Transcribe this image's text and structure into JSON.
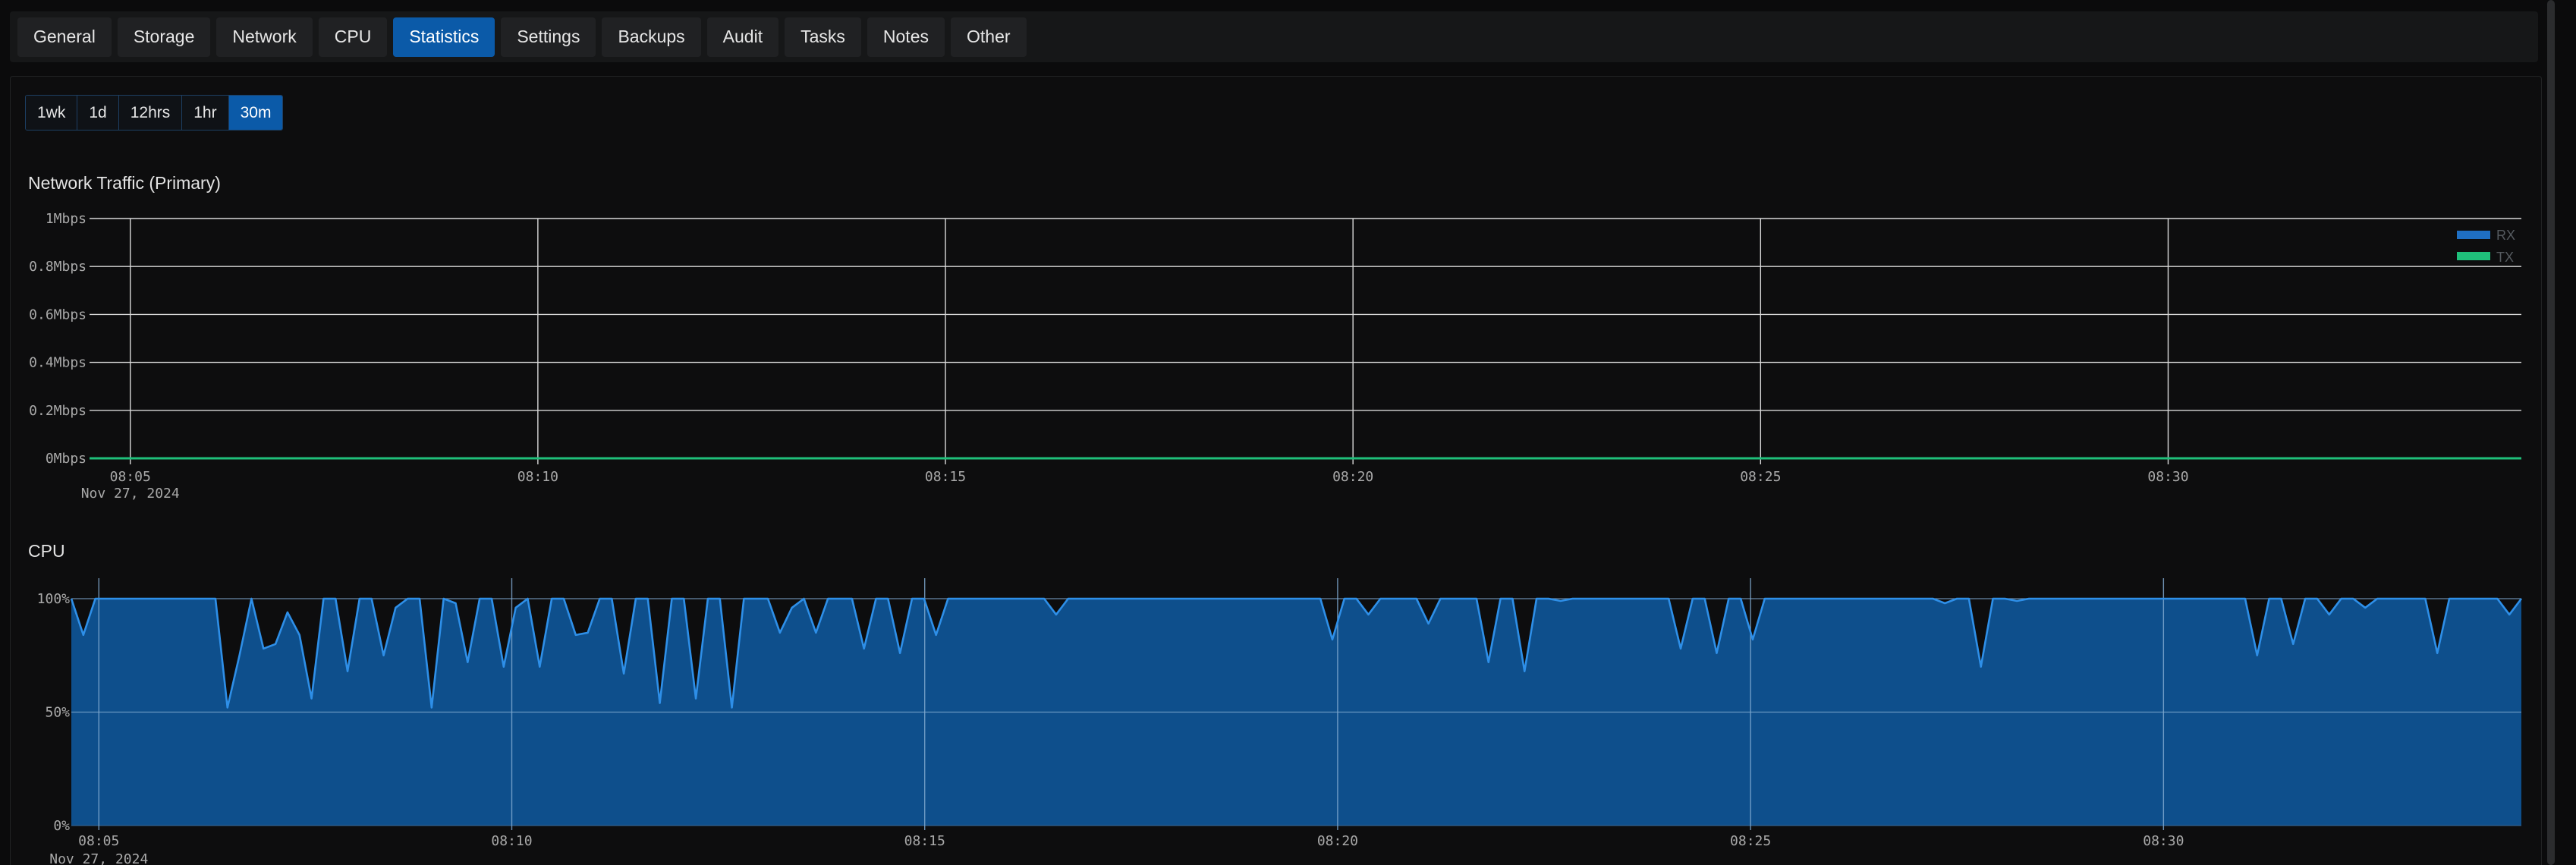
{
  "tabs": [
    {
      "label": "General"
    },
    {
      "label": "Storage"
    },
    {
      "label": "Network"
    },
    {
      "label": "CPU"
    },
    {
      "label": "Statistics",
      "active": true
    },
    {
      "label": "Settings"
    },
    {
      "label": "Backups"
    },
    {
      "label": "Audit"
    },
    {
      "label": "Tasks"
    },
    {
      "label": "Notes"
    },
    {
      "label": "Other"
    }
  ],
  "ranges": [
    {
      "label": "1wk"
    },
    {
      "label": "1d"
    },
    {
      "label": "12hrs"
    },
    {
      "label": "1hr"
    },
    {
      "label": "30m",
      "active": true
    }
  ],
  "colors": {
    "accent": "#0b5aa8",
    "rx": "#1f6fc4",
    "tx": "#1fbf7a",
    "cpu_line": "#2e8fe8",
    "cpu_fill": "#0e4f8c"
  },
  "network_chart": {
    "title": "Network Traffic (Primary)",
    "date_label": "Nov 27, 2024",
    "legend": [
      "RX",
      "TX"
    ]
  },
  "cpu_chart": {
    "title": "CPU",
    "date_label": "Nov 27, 2024"
  },
  "chart_data": [
    {
      "type": "line",
      "title": "Network Traffic (Primary)",
      "x_ticks": [
        "08:05",
        "08:10",
        "08:15",
        "08:20",
        "08:25",
        "08:30"
      ],
      "y_ticks": [
        "0Mbps",
        "0.2Mbps",
        "0.4Mbps",
        "0.6Mbps",
        "0.8Mbps",
        "1Mbps"
      ],
      "ylim": [
        0,
        1
      ],
      "x_range": [
        "08:04:30",
        "08:34:20"
      ],
      "grid": true,
      "legend_position": "top-right",
      "series": [
        {
          "name": "RX",
          "values": [
            0,
            0
          ]
        },
        {
          "name": "TX",
          "values": [
            0,
            0
          ]
        }
      ]
    },
    {
      "type": "area",
      "title": "CPU",
      "x_ticks": [
        "08:05",
        "08:10",
        "08:15",
        "08:20",
        "08:25",
        "08:30"
      ],
      "y_ticks": [
        "0%",
        "50%",
        "100%"
      ],
      "ylim": [
        0,
        100
      ],
      "x_range": [
        "08:04:40",
        "08:34:20"
      ],
      "grid": true,
      "series": [
        {
          "values": [
            100,
            84,
            100,
            100,
            100,
            100,
            100,
            100,
            100,
            100,
            100,
            100,
            100,
            52,
            75,
            100,
            78,
            80,
            94,
            84,
            56,
            100,
            100,
            68,
            100,
            100,
            75,
            96,
            100,
            100,
            52,
            100,
            98,
            72,
            100,
            100,
            70,
            96,
            100,
            70,
            100,
            100,
            84,
            85,
            100,
            100,
            67,
            100,
            100,
            54,
            100,
            100,
            56,
            100,
            100,
            52,
            100,
            100,
            100,
            85,
            96,
            100,
            85,
            100,
            100,
            100,
            78,
            100,
            100,
            76,
            100,
            100,
            84,
            100,
            100,
            100,
            100,
            100,
            100,
            100,
            100,
            100,
            93,
            100,
            100,
            100,
            100,
            100,
            100,
            100,
            100,
            100,
            100,
            100,
            100,
            100,
            100,
            100,
            100,
            100,
            100,
            100,
            100,
            100,
            100,
            82,
            100,
            100,
            93,
            100,
            100,
            100,
            100,
            89,
            100,
            100,
            100,
            100,
            72,
            100,
            100,
            68,
            100,
            100,
            99,
            100,
            100,
            100,
            100,
            100,
            100,
            100,
            100,
            100,
            78,
            100,
            100,
            76,
            100,
            100,
            82,
            100,
            100,
            100,
            100,
            100,
            100,
            100,
            100,
            100,
            100,
            100,
            100,
            100,
            100,
            100,
            98,
            100,
            100,
            70,
            100,
            100,
            99,
            100,
            100,
            100,
            100,
            100,
            100,
            100,
            100,
            100,
            100,
            100,
            100,
            100,
            100,
            100,
            100,
            100,
            100,
            100,
            75,
            100,
            100,
            80,
            100,
            100,
            93,
            100,
            100,
            96,
            100,
            100,
            100,
            100,
            100,
            76,
            100,
            100,
            100,
            100,
            100,
            93,
            100
          ]
        }
      ]
    }
  ]
}
